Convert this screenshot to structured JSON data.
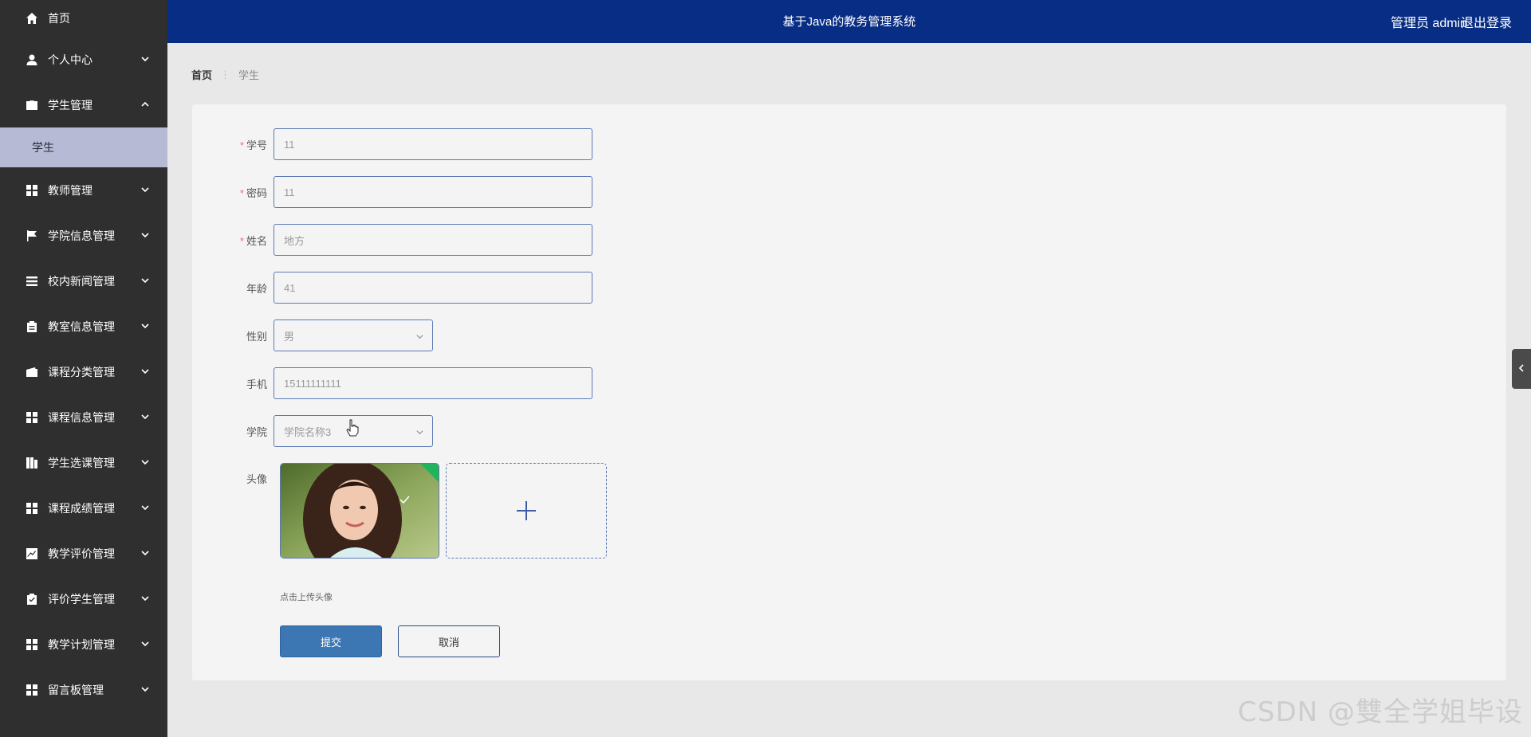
{
  "app": {
    "title": "基于Java的教务管理系统",
    "user_label": "管理员 admin",
    "logout_label": "退出登录"
  },
  "sidebar": {
    "items": [
      {
        "label": "首页",
        "icon": "home-icon",
        "expandable": false
      },
      {
        "label": "个人中心",
        "icon": "user-icon",
        "expandable": true
      },
      {
        "label": "学生管理",
        "icon": "briefcase-icon",
        "expandable": true,
        "expanded": true,
        "children": [
          {
            "label": "学生",
            "active": true
          }
        ]
      },
      {
        "label": "教师管理",
        "icon": "grid-icon",
        "expandable": true
      },
      {
        "label": "学院信息管理",
        "icon": "flag-icon",
        "expandable": true
      },
      {
        "label": "校内新闻管理",
        "icon": "list-icon",
        "expandable": true
      },
      {
        "label": "教室信息管理",
        "icon": "clipboard-icon",
        "expandable": true
      },
      {
        "label": "课程分类管理",
        "icon": "wallet-icon",
        "expandable": true
      },
      {
        "label": "课程信息管理",
        "icon": "grid-icon",
        "expandable": true
      },
      {
        "label": "学生选课管理",
        "icon": "columns-icon",
        "expandable": true
      },
      {
        "label": "课程成绩管理",
        "icon": "grid-icon",
        "expandable": true
      },
      {
        "label": "教学评价管理",
        "icon": "chart-icon",
        "expandable": true
      },
      {
        "label": "评价学生管理",
        "icon": "clipboard-check-icon",
        "expandable": true
      },
      {
        "label": "教学计划管理",
        "icon": "grid-icon",
        "expandable": true
      },
      {
        "label": "留言板管理",
        "icon": "grid-icon",
        "expandable": true
      }
    ]
  },
  "breadcrumb": {
    "home": "首页",
    "separator": "⋮",
    "current": "学生"
  },
  "form": {
    "fields": [
      {
        "label": "学号",
        "required": true,
        "value": "11",
        "type": "input"
      },
      {
        "label": "密码",
        "required": true,
        "value": "11",
        "type": "input"
      },
      {
        "label": "姓名",
        "required": true,
        "value": "地方",
        "type": "input"
      },
      {
        "label": "年龄",
        "required": false,
        "value": "41",
        "type": "input"
      },
      {
        "label": "性别",
        "required": false,
        "value": "男",
        "type": "select"
      },
      {
        "label": "手机",
        "required": false,
        "value": "15111111111",
        "type": "input"
      },
      {
        "label": "学院",
        "required": false,
        "value": "学院名称3",
        "type": "select"
      }
    ],
    "avatar_label": "头像",
    "upload_tip": "点击上传头像",
    "submit_label": "提交",
    "cancel_label": "取消"
  },
  "watermark": "CSDN @雙全学姐毕设",
  "colors": {
    "header_bg": "#082d84",
    "sidebar_bg": "#2f2f2f",
    "sidebar_active_bg": "#b6bad4",
    "primary_button": "#3c77b3",
    "input_border": "#5c79b5",
    "required_mark": "#f56c6c"
  }
}
